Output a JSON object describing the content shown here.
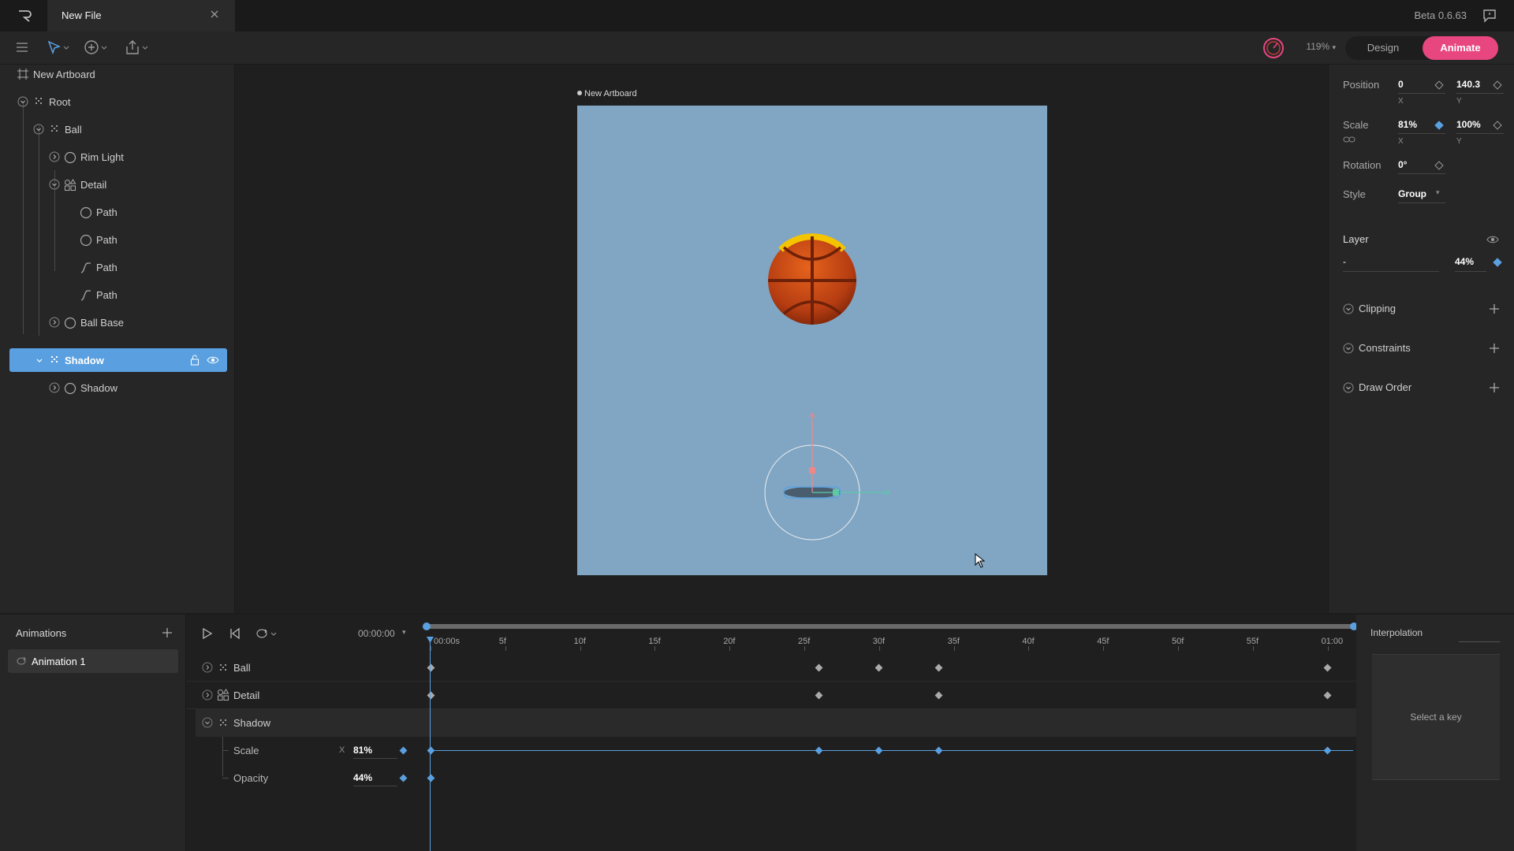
{
  "window": {
    "tab_title": "New File",
    "version": "Beta 0.6.63"
  },
  "toolbar": {
    "zoom": "119%",
    "design_label": "Design",
    "animate_label": "Animate"
  },
  "hierarchy": {
    "artboard": "New Artboard",
    "items": [
      {
        "label": "Root"
      },
      {
        "label": "Ball"
      },
      {
        "label": "Rim Light"
      },
      {
        "label": "Detail"
      },
      {
        "label": "Path"
      },
      {
        "label": "Path"
      },
      {
        "label": "Path"
      },
      {
        "label": "Path"
      },
      {
        "label": "Ball Base"
      },
      {
        "label": "Shadow"
      },
      {
        "label": "Shadow"
      }
    ]
  },
  "canvas": {
    "artboard_label": "New Artboard"
  },
  "inspector": {
    "position_label": "Position",
    "position_x": "0",
    "position_y": "140.3",
    "x_label": "X",
    "y_label": "Y",
    "scale_label": "Scale",
    "scale_x": "81%",
    "scale_y": "100%",
    "rotation_label": "Rotation",
    "rotation": "0°",
    "style_label": "Style",
    "style_value": "Group",
    "layer_label": "Layer",
    "layer_blend": "-",
    "layer_opacity": "44%",
    "clipping": "Clipping",
    "constraints": "Constraints",
    "draw_order": "Draw Order"
  },
  "animations": {
    "title": "Animations",
    "items": [
      "Animation 1"
    ]
  },
  "timeline": {
    "time": "00:00:00",
    "ticks": [
      "00:00s",
      "5f",
      "10f",
      "15f",
      "20f",
      "25f",
      "30f",
      "35f",
      "40f",
      "45f",
      "50f",
      "55f",
      "01:00"
    ],
    "tracks": {
      "ball": "Ball",
      "detail": "Detail",
      "shadow": "Shadow",
      "scale": "Scale",
      "scale_axis": "X",
      "scale_value": "81%",
      "opacity": "Opacity",
      "opacity_value": "44%"
    }
  },
  "interpolation": {
    "title": "Interpolation",
    "empty": "Select a key"
  }
}
